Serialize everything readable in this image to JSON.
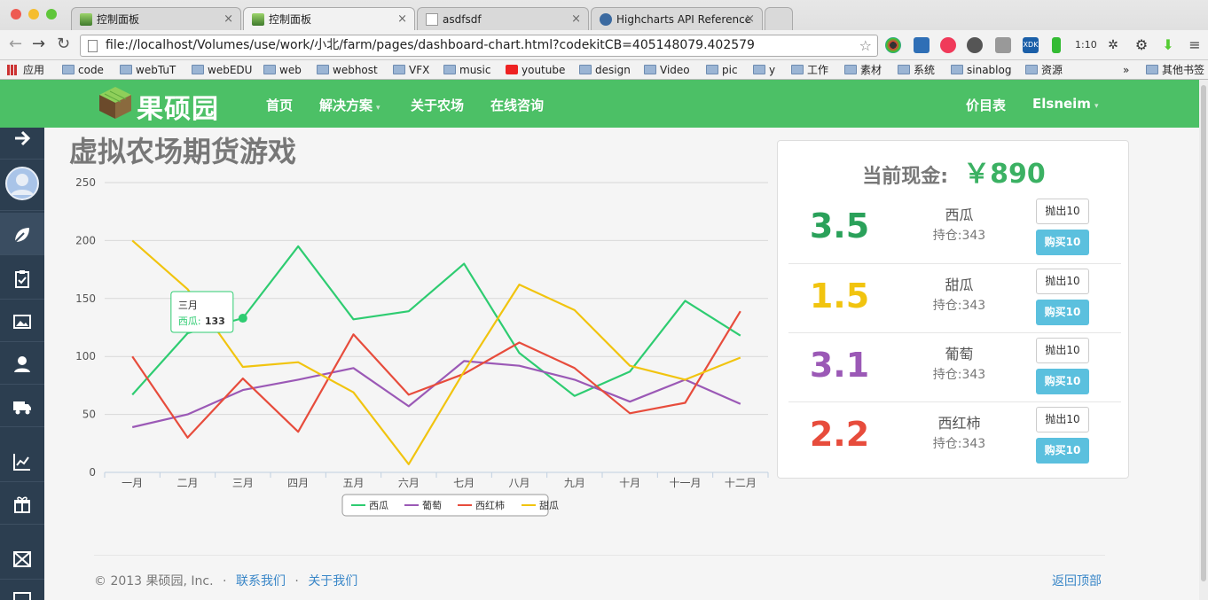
{
  "browser": {
    "tabs": [
      {
        "label": "控制面板",
        "active": false
      },
      {
        "label": "控制面板",
        "active": true
      },
      {
        "label": "asdfsdf",
        "active": false
      },
      {
        "label": "Highcharts API Reference",
        "active": false
      }
    ],
    "tab_close": "×",
    "url": "file://localhost/Volumes/use/work/小北/farm/pages/dashboard-chart.html?codekitCB=405148079.402579",
    "ext_zoom_label": "1:10",
    "bookmarks": [
      "应用",
      "code",
      "webTuT",
      "webEDU",
      "web",
      "webhost",
      "VFX",
      "music",
      "youtube",
      "design",
      "Video",
      "pic",
      "y",
      "工作",
      "素材",
      "系统",
      "sinablog",
      "资源"
    ],
    "bookmarks_more": "»",
    "bookmarks_other": "其他书签"
  },
  "nav": {
    "brand": "果硕园",
    "items": [
      "首页",
      "解决方案",
      "关于农场",
      "在线咨询"
    ],
    "right": [
      "价目表",
      "Elsneim"
    ],
    "caret": "▾"
  },
  "page": {
    "title": "虚拟农场期货游戏"
  },
  "chart_data": {
    "type": "line",
    "categories": [
      "一月",
      "二月",
      "三月",
      "四月",
      "五月",
      "六月",
      "七月",
      "八月",
      "九月",
      "十月",
      "十一月",
      "十二月"
    ],
    "series": [
      {
        "name": "西瓜",
        "color": "#2ecc71",
        "values": [
          67,
          120,
          133,
          195,
          132,
          139,
          180,
          103,
          66,
          87,
          148,
          118
        ]
      },
      {
        "name": "葡萄",
        "color": "#9b59b6",
        "values": [
          39,
          50,
          71,
          80,
          90,
          57,
          96,
          92,
          80,
          61,
          80,
          59
        ]
      },
      {
        "name": "西红柿",
        "color": "#e74c3c",
        "values": [
          100,
          30,
          81,
          35,
          119,
          67,
          85,
          112,
          90,
          51,
          60,
          139
        ]
      },
      {
        "name": "甜瓜",
        "color": "#f1c40f",
        "values": [
          200,
          158,
          91,
          95,
          69,
          7,
          87,
          162,
          140,
          92,
          80,
          99
        ]
      }
    ],
    "yticks": [
      0,
      50,
      100,
      150,
      200,
      250
    ],
    "ylim": [
      0,
      250
    ],
    "grid": true,
    "legend": "bottom-center",
    "tooltip": {
      "category": "三月",
      "series": "西瓜",
      "sep": ": ",
      "value": "133"
    }
  },
  "panel": {
    "cash_label": "当前现金:",
    "cash_amount": "￥890",
    "items": [
      {
        "price": "3.5",
        "name": "西瓜",
        "hold": "持仓:343",
        "color": "#2aa15a",
        "sell": "抛出10",
        "buy": "购买10"
      },
      {
        "price": "1.5",
        "name": "甜瓜",
        "hold": "持仓:343",
        "color": "#f1c40f",
        "sell": "抛出10",
        "buy": "购买10"
      },
      {
        "price": "3.1",
        "name": "葡萄",
        "hold": "持仓:343",
        "color": "#9b59b6",
        "sell": "抛出10",
        "buy": "购买10"
      },
      {
        "price": "2.2",
        "name": "西红柿",
        "hold": "持仓:343",
        "color": "#e74c3c",
        "sell": "抛出10",
        "buy": "购买10"
      }
    ]
  },
  "footer": {
    "copyright": "© 2013 果硕园, Inc.",
    "dot": "·",
    "links": [
      "联系我们",
      "关于我们"
    ],
    "back_to_top": "返回顶部"
  }
}
